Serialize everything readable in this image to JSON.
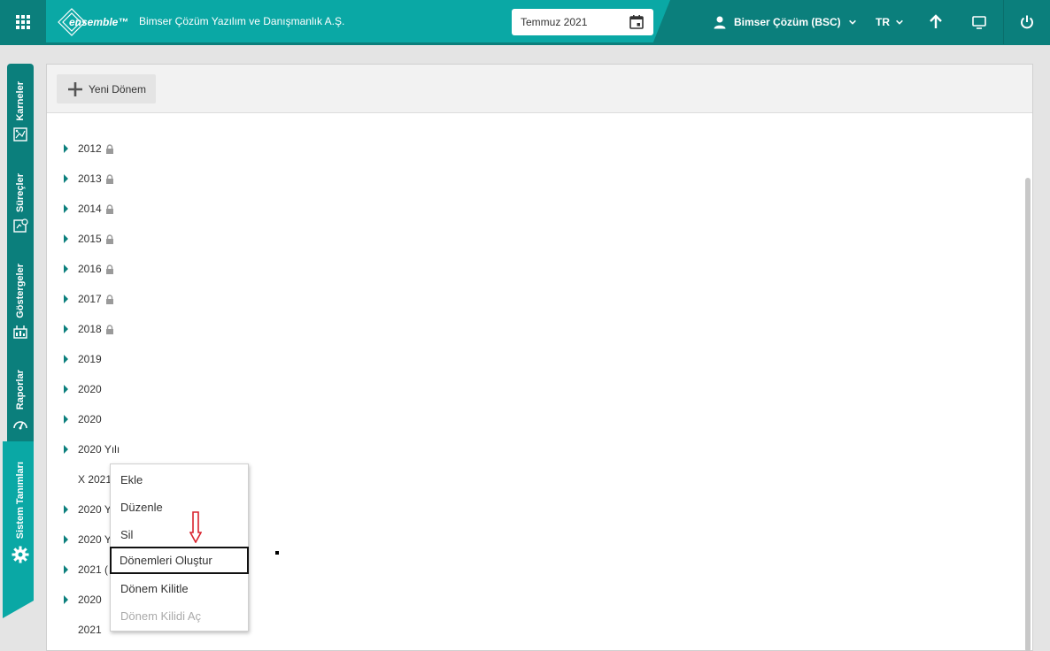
{
  "header": {
    "logo_text": "ensemble™",
    "company": "Bimser Çözüm Yazılım ve Danışmanlık A.Ş.",
    "period": "Temmuz 2021",
    "user": "Bimser Çözüm (BSC)",
    "language": "TR",
    "icons": [
      "apps-grid-icon",
      "calendar-icon",
      "user-icon",
      "chevron-down-icon",
      "arrow-up-icon",
      "monitor-icon",
      "power-icon"
    ]
  },
  "sidenav": {
    "items": [
      {
        "label": "Karneler",
        "icon": "scorecard-icon"
      },
      {
        "label": "Süreçler",
        "icon": "process-icon"
      },
      {
        "label": "Göstergeler",
        "icon": "indicator-icon"
      },
      {
        "label": "Raporlar",
        "icon": "report-gauge-icon"
      },
      {
        "label": "Sistem Tanımları",
        "icon": "gear-icon",
        "active": true
      }
    ]
  },
  "toolbar": {
    "new_period_label": "Yeni Dönem"
  },
  "tree": {
    "rows": [
      {
        "label": "2012",
        "locked": true,
        "expandable": true
      },
      {
        "label": "2013",
        "locked": true,
        "expandable": true
      },
      {
        "label": "2014",
        "locked": true,
        "expandable": true
      },
      {
        "label": "2015",
        "locked": true,
        "expandable": true
      },
      {
        "label": "2016",
        "locked": true,
        "expandable": true
      },
      {
        "label": "2017",
        "locked": true,
        "expandable": true
      },
      {
        "label": "2018",
        "locked": true,
        "expandable": true
      },
      {
        "label": "2019",
        "locked": false,
        "expandable": true
      },
      {
        "label": "2020",
        "locked": false,
        "expandable": true
      },
      {
        "label": "2020",
        "locked": false,
        "expandable": true
      },
      {
        "label": "2020 Yılı",
        "locked": false,
        "expandable": true
      },
      {
        "label": "X 2021",
        "locked": false,
        "expandable": false
      },
      {
        "label": "2020 Y",
        "locked": false,
        "expandable": true
      },
      {
        "label": "2020 Y",
        "locked": false,
        "expandable": true
      },
      {
        "label": "2021 (",
        "locked": false,
        "expandable": true
      },
      {
        "label": "2020",
        "locked": false,
        "expandable": true
      },
      {
        "label": "2021",
        "locked": false,
        "expandable": false
      }
    ]
  },
  "context_menu": {
    "items": [
      {
        "label": "Ekle",
        "enabled": true
      },
      {
        "label": "Düzenle",
        "enabled": true
      },
      {
        "label": "Sil",
        "enabled": true
      },
      {
        "label": "Dönemleri Oluştur",
        "enabled": true,
        "highlighted": true
      },
      {
        "label": "Dönem Kilitle",
        "enabled": true
      },
      {
        "label": "Dönem Kilidi Aç",
        "enabled": false
      }
    ]
  },
  "colors": {
    "teal": "#0aa8a5",
    "teal_dark": "#0b7f7c",
    "annotation_red": "#d9232e"
  }
}
